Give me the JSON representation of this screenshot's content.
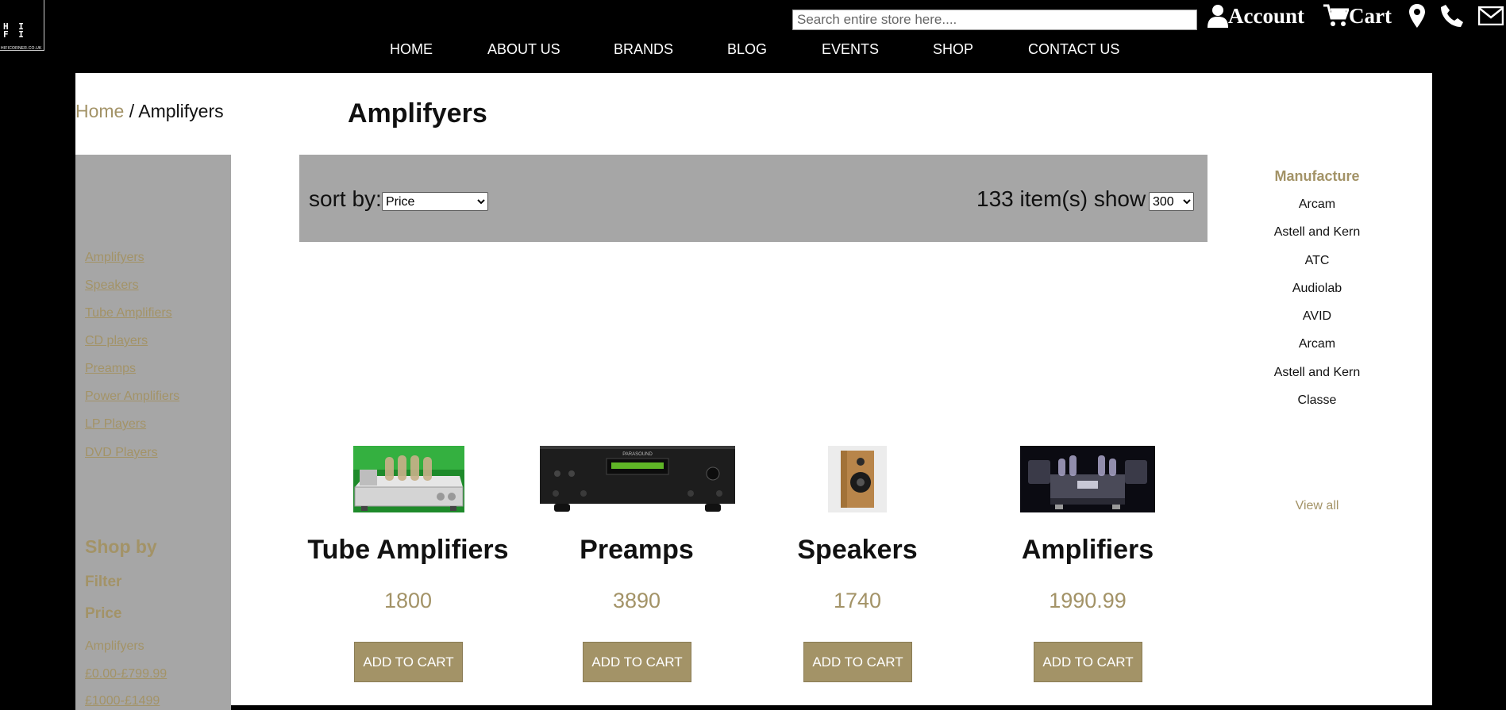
{
  "logo": {
    "text": "H I\nF I",
    "url_text": "HIFICORNER.CO.UK"
  },
  "search": {
    "placeholder": "Search entire store here...."
  },
  "utilities": {
    "account_label": "Account",
    "cart_label": "Cart"
  },
  "nav": [
    "HOME",
    "ABOUT US",
    "BRANDS",
    "BLOG",
    "EVENTS",
    "SHOP",
    "CONTACT US"
  ],
  "breadcrumb": {
    "home": "Home",
    "separator": " / ",
    "current": "Amplifyers"
  },
  "page_title": "Amplifyers",
  "sidebar": {
    "categories": [
      "Amplifyers",
      "Speakers",
      "Tube Amplifiers",
      "CD players",
      "Preamps",
      "Power Amplifiers",
      "LP Players",
      "DVD Players"
    ],
    "shop_by": "Shop by",
    "filter": "Filter",
    "price": "Price",
    "price_type": "Amplifyers",
    "price_ranges": [
      "£0.00-£799.99",
      "£1000-£1499"
    ]
  },
  "sortbar": {
    "sort_label": "sort by:",
    "sort_selected": "Price",
    "count_text": "133 item(s) show",
    "show_selected": "300"
  },
  "manufacture": {
    "heading": "Manufacture",
    "items": [
      "Arcam",
      "Astell and Kern",
      "ATC",
      "Audiolab",
      "AVID",
      "Arcam",
      "Astell and Kern",
      "Classe"
    ],
    "view_all": "View all"
  },
  "products": [
    {
      "name": "Tube Amplifiers",
      "price": "1800",
      "button": "ADD TO CART"
    },
    {
      "name": "Preamps",
      "price": "3890",
      "button": "ADD TO CART"
    },
    {
      "name": "Speakers",
      "price": "1740",
      "button": "ADD TO CART"
    },
    {
      "name": "Amplifiers",
      "price": "1990.99",
      "button": "ADD TO CART"
    }
  ],
  "colors": {
    "accent": "#a39367",
    "header_bg": "#000000",
    "sidebar_bg": "#a6a6a6",
    "panel_bg": "#ffffff"
  },
  "preamp_display_text": "PARASOUND"
}
